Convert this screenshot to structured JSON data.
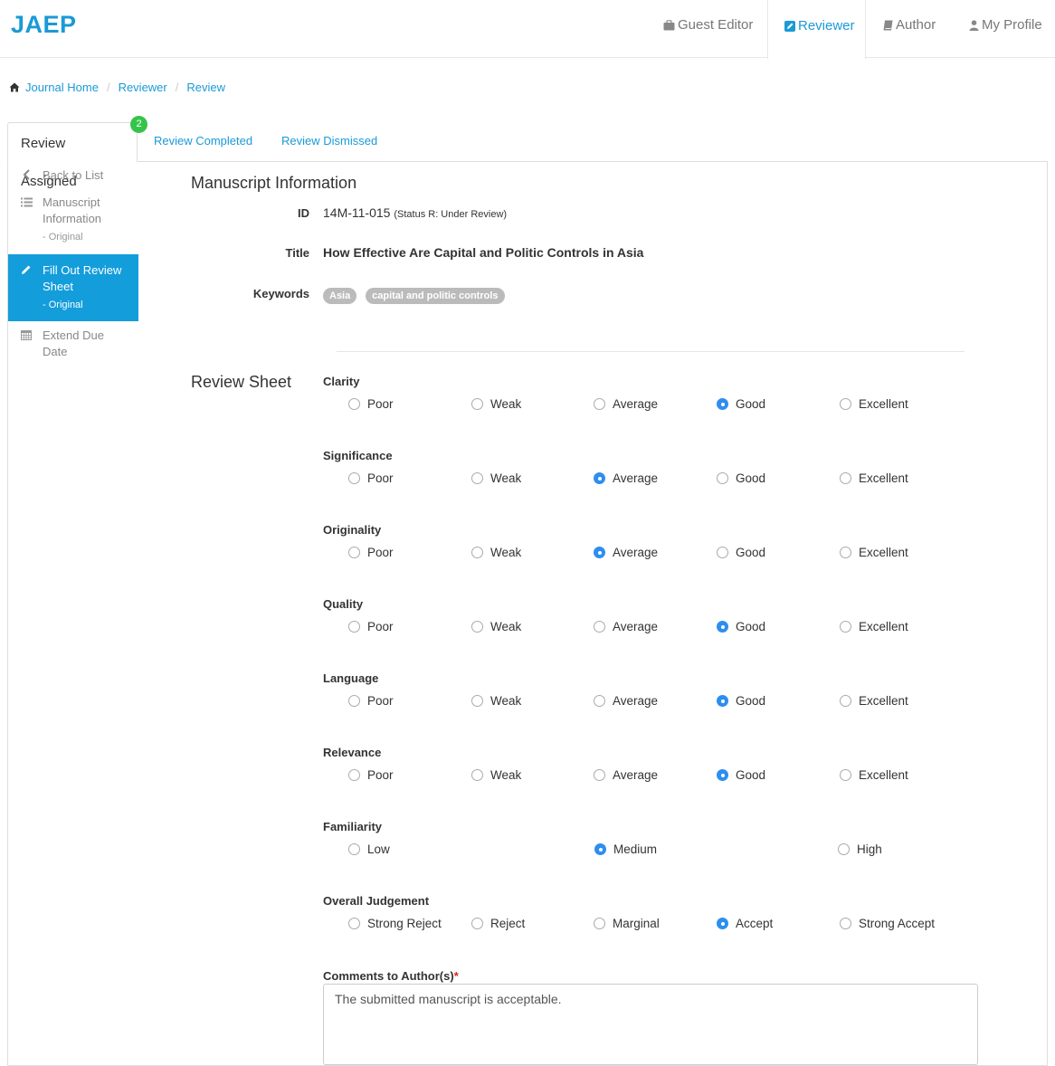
{
  "brand": "JAEP",
  "nav": {
    "guest_editor": "Guest Editor",
    "reviewer": "Reviewer",
    "author": "Author",
    "my_profile": "My Profile"
  },
  "breadcrumb": [
    "Journal Home",
    "Reviewer",
    "Review"
  ],
  "tabs": {
    "assigned": "Review Assigned",
    "assigned_count": "2",
    "completed": "Review Completed",
    "dismissed": "Review Dismissed"
  },
  "side_menu": {
    "back": "Back to List",
    "manuscript_info": "Manuscript Information",
    "manuscript_info_sub": "- Original",
    "fill_out": "Fill Out Review Sheet",
    "fill_out_sub": "- Original",
    "extend": "Extend Due Date"
  },
  "manuscript": {
    "heading": "Manuscript Information",
    "id_label": "ID",
    "id_value": "14M-11-015",
    "status": "(Status R: Under Review)",
    "title_label": "Title",
    "title_value": "How Effective Are Capital and Politic Controls in Asia",
    "keywords_label": "Keywords",
    "keywords": [
      "Asia",
      "capital and politic controls"
    ]
  },
  "review_sheet": {
    "heading": "Review Sheet",
    "questions": [
      {
        "label": "Clarity",
        "options": [
          "Poor",
          "Weak",
          "Average",
          "Good",
          "Excellent"
        ],
        "selected": "Good"
      },
      {
        "label": "Significance",
        "options": [
          "Poor",
          "Weak",
          "Average",
          "Good",
          "Excellent"
        ],
        "selected": "Average"
      },
      {
        "label": "Originality",
        "options": [
          "Poor",
          "Weak",
          "Average",
          "Good",
          "Excellent"
        ],
        "selected": "Average"
      },
      {
        "label": "Quality",
        "options": [
          "Poor",
          "Weak",
          "Average",
          "Good",
          "Excellent"
        ],
        "selected": "Good"
      },
      {
        "label": "Language",
        "options": [
          "Poor",
          "Weak",
          "Average",
          "Good",
          "Excellent"
        ],
        "selected": "Good"
      },
      {
        "label": "Relevance",
        "options": [
          "Poor",
          "Weak",
          "Average",
          "Good",
          "Excellent"
        ],
        "selected": "Good"
      },
      {
        "label": "Familiarity",
        "options": [
          "Low",
          "Medium",
          "High"
        ],
        "selected": "Medium"
      },
      {
        "label": "Overall Judgement",
        "options": [
          "Strong Reject",
          "Reject",
          "Marginal",
          "Accept",
          "Strong Accept"
        ],
        "selected": "Accept"
      }
    ],
    "comments_label": "Comments to Author(s)",
    "required_mark": "*",
    "comments_value": "The submitted manuscript is acceptable."
  },
  "colors": {
    "accent": "#1a9ad6",
    "active_menu": "#139ddb",
    "badge": "#35c44b",
    "radio_selected": "#2d8ef0",
    "required": "#d9231c"
  }
}
